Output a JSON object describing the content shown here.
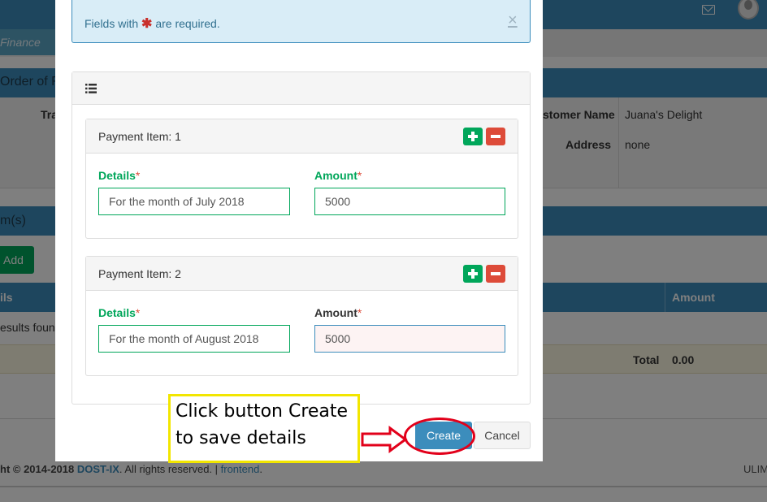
{
  "background": {
    "breadcrumb_text": "Finance",
    "order_title": "Order of F",
    "info": {
      "transaction_label": "Tra",
      "customer_label": "stomer Name",
      "customer_value": "Juana's Delight",
      "address_label": "Address",
      "address_value": "none"
    },
    "items_title": "m(s)",
    "add_button": "Add",
    "table": {
      "col_details": "ils",
      "col_amount": "Amount",
      "no_results": "esults found",
      "total_label": "Total",
      "total_value": "0.00"
    },
    "footer": {
      "prefix": "ht © 2014-2018 ",
      "org": "DOST-IX",
      "rights": ". All rights reserved. | ",
      "link": "frontend",
      "suffix": ".",
      "right_text": "ULIM"
    }
  },
  "modal": {
    "alert": {
      "text_before": "Fields with ",
      "star": "✱",
      "text_after": " are required.",
      "close": "×"
    },
    "list_icon": "list-icon",
    "payment_items": [
      {
        "title": "Payment Item: 1",
        "details_label": "Details",
        "details_value": "For the month of July 2018",
        "amount_label": "Amount",
        "amount_value": "5000"
      },
      {
        "title": "Payment Item: 2",
        "details_label": "Details",
        "details_value": "For the month of August 2018",
        "amount_label": "Amount",
        "amount_value": "5000"
      }
    ],
    "required_mark": "*",
    "create_button": "Create",
    "cancel_button": "Cancel"
  },
  "annotation": {
    "callout_line1": "Click button Create",
    "callout_line2": "to save details"
  },
  "colors": {
    "primary": "#3c8dbc",
    "success": "#00a65a",
    "danger": "#dd4b39",
    "callout_border": "#f2e600",
    "annotation_red": "#e2001a"
  }
}
